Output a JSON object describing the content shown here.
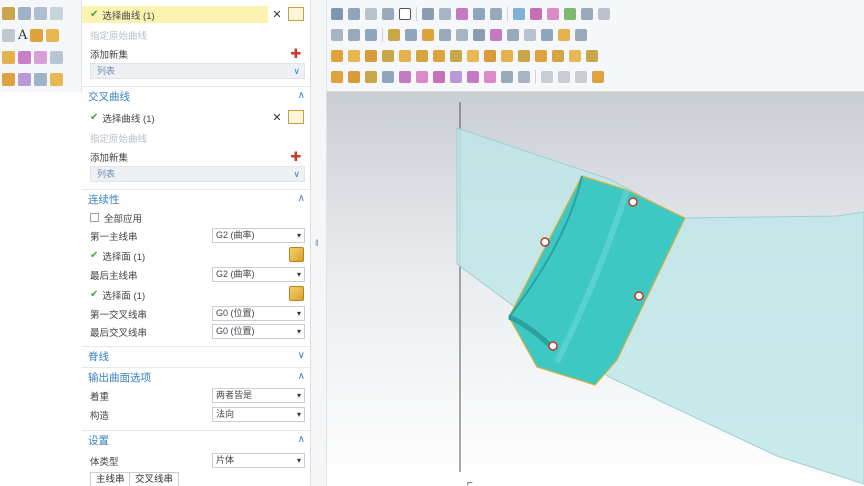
{
  "panel": {
    "section1": {
      "select_curve": "选择曲线 (1)",
      "specify_origin": "指定原始曲线",
      "add_new_set": "添加新集",
      "list_label": "列表"
    },
    "section2": {
      "header": "交叉曲线",
      "select_curve": "选择曲线 (1)",
      "specify_origin": "指定原始曲线",
      "add_new_set": "添加新集",
      "list_label": "列表"
    },
    "continuity": {
      "header": "连续性",
      "apply_all": "全部应用",
      "first_primary_label": "第一主线串",
      "first_primary_value": "G2 (曲率)",
      "select_face_1": "选择面 (1)",
      "last_primary_label": "最后主线串",
      "last_primary_value": "G2 (曲率)",
      "select_face_2": "选择面 (1)",
      "first_cross_label": "第一交叉线串",
      "first_cross_value": "G0 (位置)",
      "last_cross_label": "最后交叉线串",
      "last_cross_value": "G0 (位置)"
    },
    "spine": {
      "header": "脊线"
    },
    "output": {
      "header": "输出曲面选项",
      "emphasis_label": "着重",
      "emphasis_value": "两者皆是",
      "construct_label": "构造",
      "construct_value": "法向"
    },
    "settings": {
      "header": "设置",
      "body_type_label": "体类型",
      "body_type_value": "片体",
      "tab_primary": "主线串",
      "tab_cross": "交叉线串"
    }
  },
  "left_ribbon": {
    "letter": "A"
  },
  "colors": {
    "accent": "#3a7fc1",
    "selected_row": "#fdf3b0",
    "surface": "#3ec8c4",
    "plane": "#bfe6e8"
  },
  "icons": {
    "check": "✔",
    "caret_up": "∧",
    "caret_down": "∨",
    "close": "✕",
    "plus": "✚",
    "dropdown": "▾"
  }
}
